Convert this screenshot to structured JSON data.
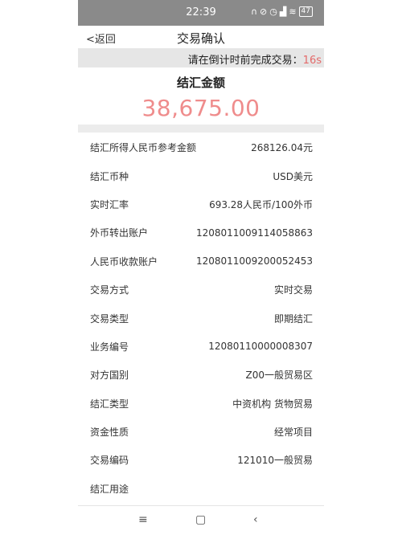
{
  "status_bar": {
    "time": "22:39",
    "battery": "47"
  },
  "nav": {
    "back_label": "<返回",
    "title": "交易确认"
  },
  "countdown": {
    "prefix": "请在倒计时前完成交易：",
    "seconds": "16s"
  },
  "amount": {
    "title": "结汇金额",
    "value": "38,675.00"
  },
  "details": [
    {
      "label": "结汇所得人民币参考金额",
      "value": "268126.04元"
    },
    {
      "label": "结汇币种",
      "value": "USD美元"
    },
    {
      "label": "实时汇率",
      "value": "693.28人民币/100外币"
    },
    {
      "label": "外币转出账户",
      "value": "1208011009114058863"
    },
    {
      "label": "人民币收款账户",
      "value": "1208011009200052453"
    },
    {
      "label": "交易方式",
      "value": "实时交易"
    },
    {
      "label": "交易类型",
      "value": "即期结汇"
    },
    {
      "label": "业务编号",
      "value": "12080110000008307"
    },
    {
      "label": "对方国别",
      "value": "Z00一般贸易区"
    },
    {
      "label": "结汇类型",
      "value": "中资机构 货物贸易"
    },
    {
      "label": "资金性质",
      "value": "经常项目"
    },
    {
      "label": "交易编码",
      "value": "121010一般贸易"
    },
    {
      "label": "结汇用途",
      "value": ""
    }
  ],
  "bottom_nav": {
    "menu": "≡",
    "home": "▢",
    "back": "‹"
  }
}
